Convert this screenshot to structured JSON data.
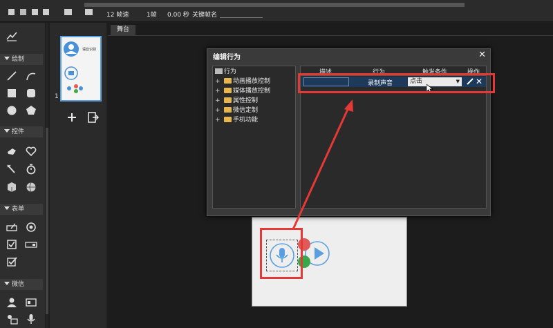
{
  "toolbar": {
    "frame_rate": "12 帧速",
    "frame_count": "1帧",
    "time": "0.00 秒",
    "keyframe_label": "关键帧名"
  },
  "panel": {
    "sections": {
      "draw": "绘制",
      "controls": "控件",
      "form": "表单",
      "wechat": "微信"
    }
  },
  "thumbnails": {
    "page_number": "1",
    "card_text": "语音识别"
  },
  "stage": {
    "tab_label": "舞台"
  },
  "dialog": {
    "title": "编辑行为",
    "tree": {
      "root": "行为",
      "items": [
        "动画播放控制",
        "媒体播放控制",
        "属性控制",
        "微信定制",
        "手机功能"
      ]
    },
    "table": {
      "headers": {
        "description": "描述",
        "action": "行为",
        "trigger": "触发条件",
        "operation": "操作"
      },
      "row": {
        "description": "",
        "action": "录制声音",
        "trigger": "点击"
      }
    }
  },
  "colors": {
    "highlight": "#e53935",
    "selection": "#1e3a5a",
    "accent": "#5aa0e0"
  }
}
